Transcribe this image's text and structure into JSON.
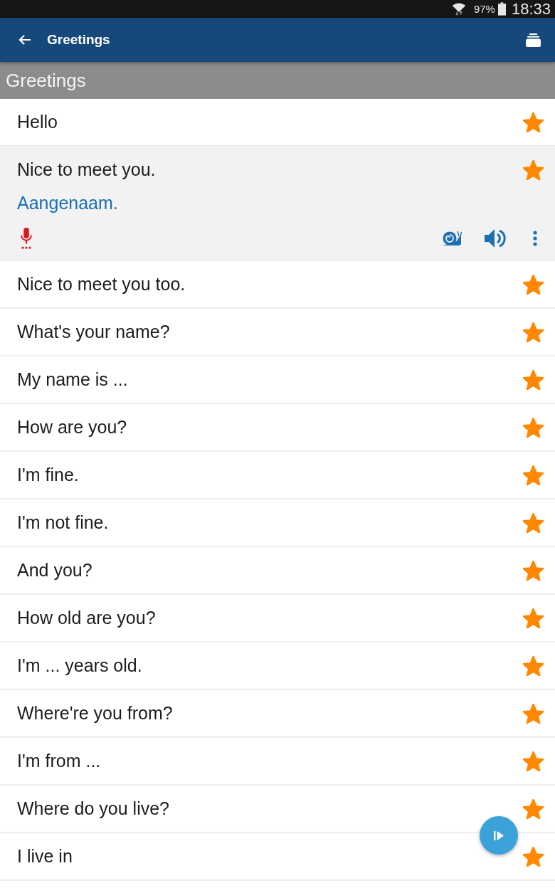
{
  "status_bar": {
    "battery": "97%",
    "time": "18:33"
  },
  "app_bar": {
    "title": "Greetings"
  },
  "section": {
    "title": "Greetings"
  },
  "phrases": [
    {
      "text": "Hello",
      "starred": true,
      "expanded": false
    },
    {
      "text": "Nice to meet you.",
      "translation": "Aangenaam.",
      "starred": true,
      "expanded": true
    },
    {
      "text": "Nice to meet you too.",
      "starred": true,
      "expanded": false
    },
    {
      "text": "What's your name?",
      "starred": true,
      "expanded": false
    },
    {
      "text": "My name is ...",
      "starred": true,
      "expanded": false
    },
    {
      "text": "How are you?",
      "starred": true,
      "expanded": false
    },
    {
      "text": "I'm fine.",
      "starred": true,
      "expanded": false
    },
    {
      "text": "I'm not fine.",
      "starred": true,
      "expanded": false
    },
    {
      "text": "And you?",
      "starred": true,
      "expanded": false
    },
    {
      "text": "How old are you?",
      "starred": true,
      "expanded": false
    },
    {
      "text": "I'm ... years old.",
      "starred": true,
      "expanded": false
    },
    {
      "text": "Where're you from?",
      "starred": true,
      "expanded": false
    },
    {
      "text": "I'm from ...",
      "starred": true,
      "expanded": false
    },
    {
      "text": "Where do you live?",
      "starred": true,
      "expanded": false
    },
    {
      "text": "I live in",
      "starred": true,
      "expanded": false
    }
  ]
}
